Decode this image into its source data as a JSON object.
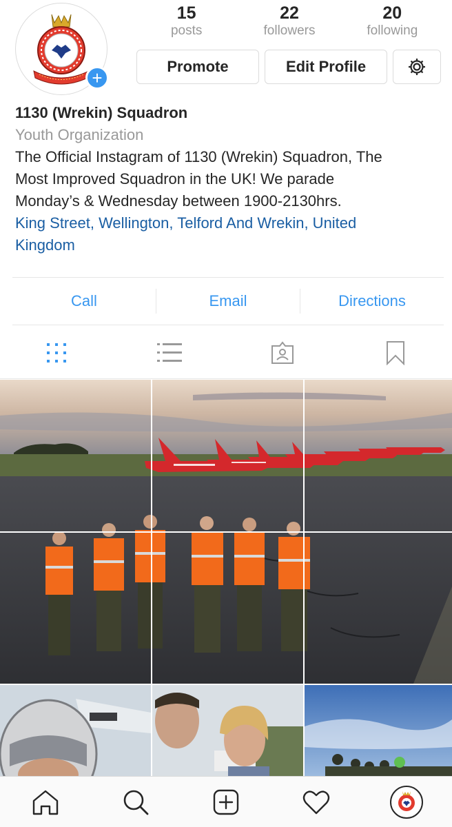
{
  "profile": {
    "stats": [
      {
        "count": "15",
        "label": "posts"
      },
      {
        "count": "22",
        "label": "followers"
      },
      {
        "count": "20",
        "label": "following"
      }
    ],
    "buttons": {
      "promote": "Promote",
      "edit_profile": "Edit Profile",
      "settings_icon": "gear-icon"
    },
    "avatar_badge_icon": "plus-icon",
    "name": "1130 (Wrekin) Squadron",
    "category": "Youth Organization",
    "bio_lines": [
      "The Official Instagram of 1130 (Wrekin) Squadron, The",
      "Most Improved Squadron in the UK! We parade",
      "Monday’s & Wednesday between 1900-2130hrs."
    ],
    "location_lines": [
      "King Street, Wellington, Telford And Wrekin, United",
      "Kingdom"
    ]
  },
  "contact": {
    "call": "Call",
    "email": "Email",
    "directions": "Directions"
  },
  "tabs": [
    {
      "icon": "grid-icon",
      "active": true
    },
    {
      "icon": "list-icon",
      "active": false
    },
    {
      "icon": "tagged-icon",
      "active": false
    },
    {
      "icon": "bookmark-icon",
      "active": false
    }
  ],
  "bottom_nav": [
    "home-icon",
    "search-icon",
    "add-post-icon",
    "heart-icon",
    "profile-avatar"
  ],
  "colors": {
    "accent_blue": "#3897f0",
    "location_blue": "#1a5ea3",
    "muted_gray": "#999999",
    "text": "#262626",
    "jet_red": "#d4282c"
  }
}
